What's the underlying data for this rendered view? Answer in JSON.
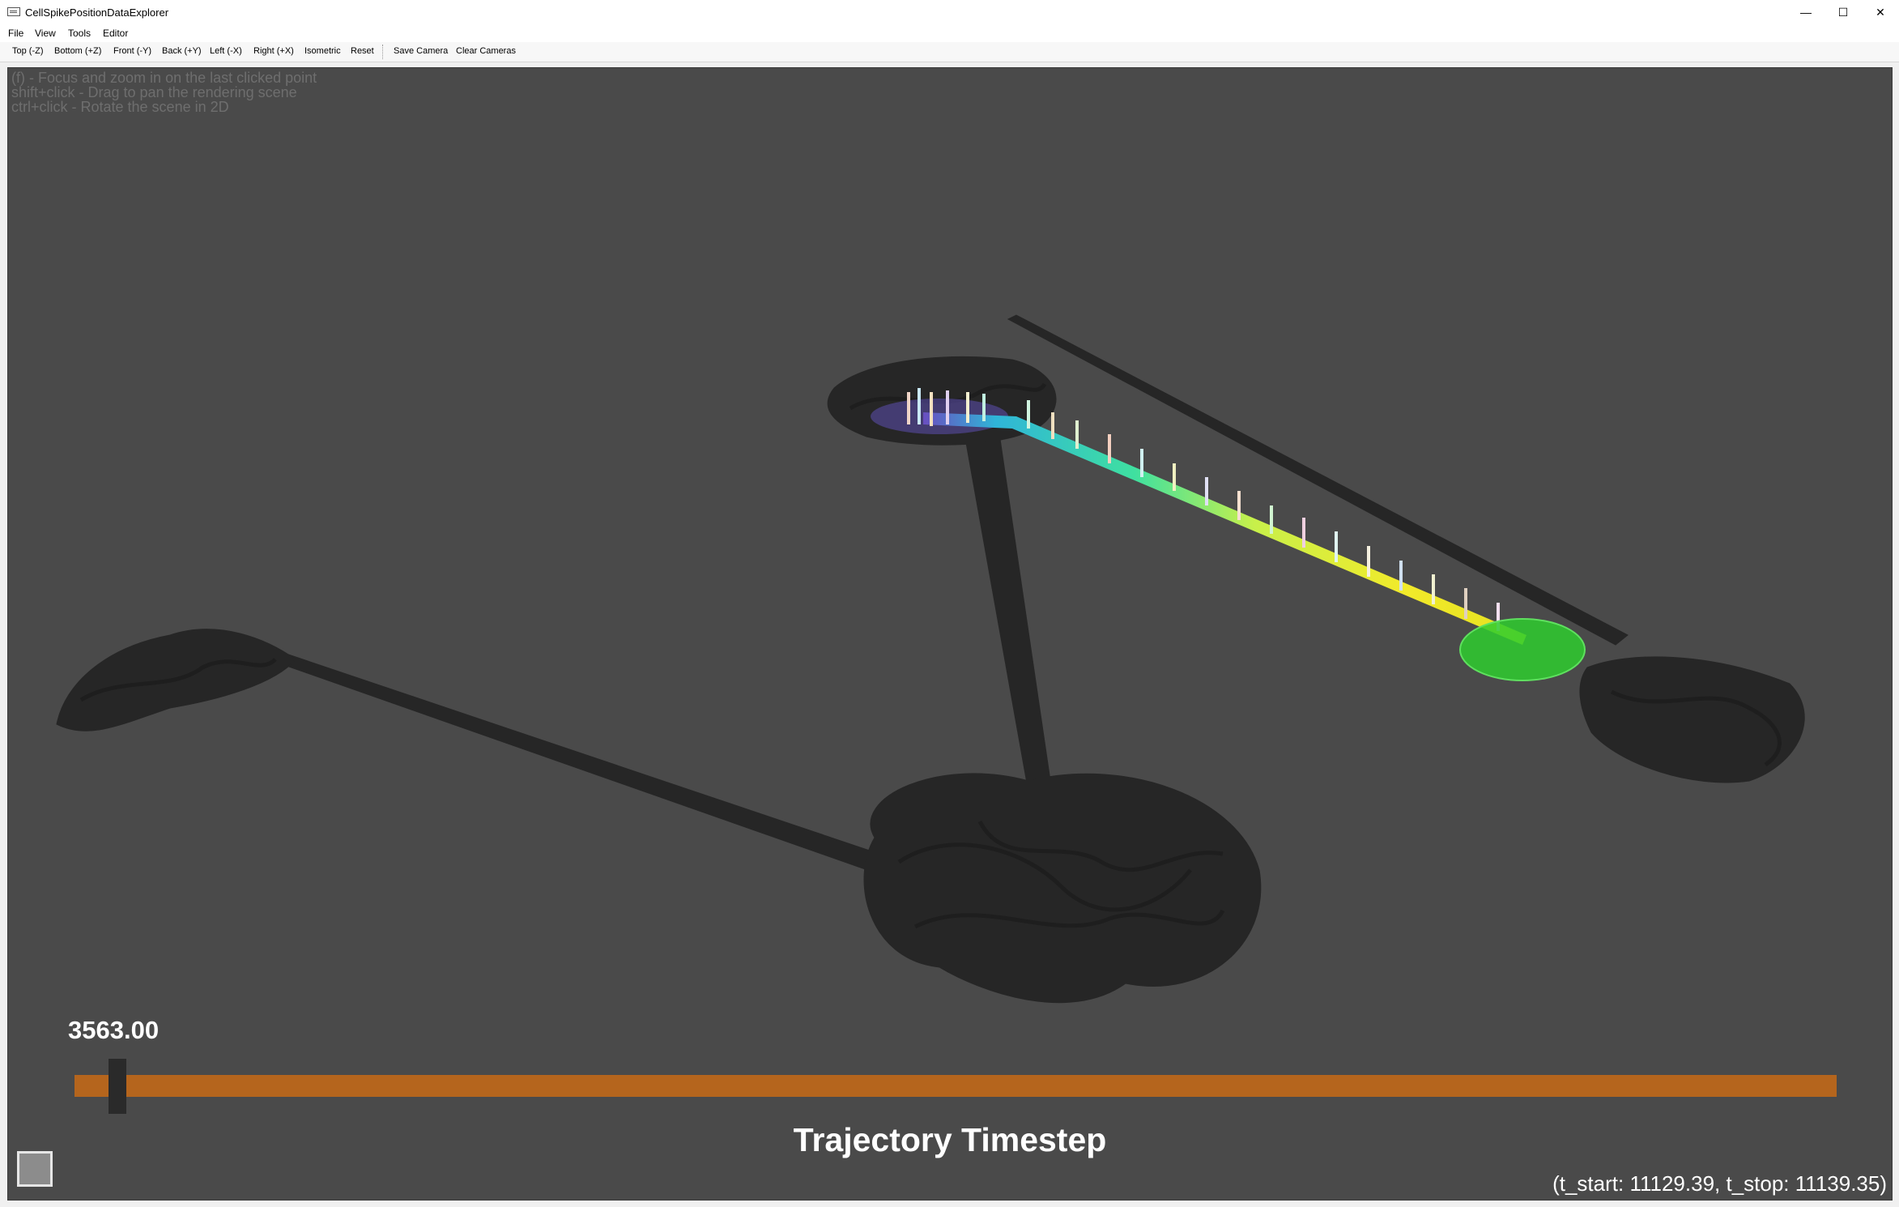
{
  "window": {
    "title": "CellSpikePositionDataExplorer",
    "minimize_glyph": "—",
    "maximize_glyph": "☐",
    "close_glyph": "✕"
  },
  "menu": [
    "File",
    "View",
    "Tools",
    "Editor"
  ],
  "toolbar": {
    "buttons": [
      "Top (-Z)",
      "Bottom (+Z)",
      "Front (-Y)",
      "Back (+Y)",
      "Left (-X)",
      "Right (+X)",
      "Isometric",
      "Reset"
    ],
    "save_camera": "Save Camera",
    "clear_cameras": "Clear Cameras"
  },
  "viewport": {
    "hints": [
      "(f) - Focus and zoom in on the last clicked point",
      "shift+click - Drag to pan the rendering scene",
      "ctrl+click - Rotate the scene in 2D"
    ],
    "slider": {
      "value_text": "3563.00",
      "title": "Trajectory Timestep",
      "fraction": 0.024
    },
    "time_range": "(t_start: 11129.39, t_stop: 11139.35)",
    "colors": {
      "background": "#4a4a4a",
      "shadow": "#262626",
      "slider_track": "#b5651d",
      "highlight_disc": "#2ecc2e"
    }
  }
}
